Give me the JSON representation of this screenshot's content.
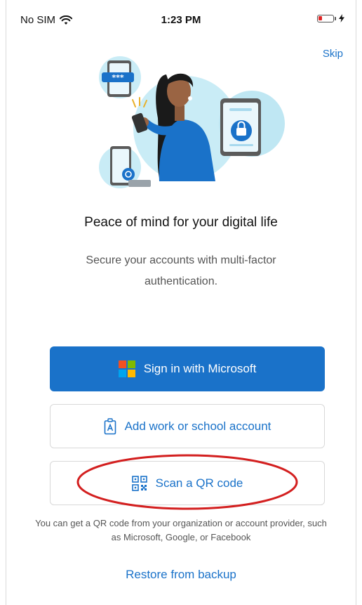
{
  "status_bar": {
    "carrier": "No SIM",
    "time": "1:23 PM",
    "wifi_icon": "wifi-icon",
    "battery_icon": "battery-low-icon",
    "charging_icon": "bolt-icon",
    "battery_color": "#e02424"
  },
  "header": {
    "skip_label": "Skip"
  },
  "illustration": {
    "name": "person-with-phone-illustration",
    "password_dots": "***"
  },
  "content": {
    "headline": "Peace of mind for your digital life",
    "subtext": "Secure your accounts with multi-factor authentication."
  },
  "actions": {
    "sign_in_label": "Sign in with Microsoft",
    "add_account_label": "Add work or school account",
    "scan_qr_label": "Scan a QR code",
    "restore_label": "Restore from backup"
  },
  "helper": {
    "qr_hint": "You can get a QR code from your organization or account provider, such as Microsoft, Google, or Facebook"
  },
  "colors": {
    "accent": "#1a72c9",
    "highlight_ring": "#d31f1f",
    "ms_red": "#f25022",
    "ms_green": "#7fba00",
    "ms_blue": "#00a4ef",
    "ms_yellow": "#ffb900"
  }
}
